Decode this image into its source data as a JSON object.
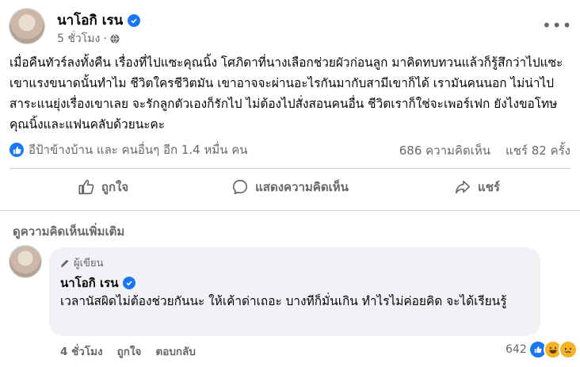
{
  "post": {
    "author": "นาโอกิ เรน",
    "time": "5 ชั่วโมง",
    "body": "เมื่อคืนทัวร์ลงทั้งคืน เรื่องที่ไปแซะคุณนิ้ง โศภิดาที่นางเลือกช่วยผัวก่อนลูก มาคิดทบทวนแล้วก็รู้สึกว่าไปแซะเขาแรงขนาดนั้นทำไม ชีวิตใครชีวิตมัน เขาอาจจะผ่านอะไรกันมากับสามีเขาก็ได้ เรามันคนนอก ไม่น่าไปสาระแนยุ่งเรื่องเขาเลย จะรักลูกตัวเองก็รักไป ไม่ต้องไปสั่งสอนคนอื่น ชีวิตเราก็ใช่จะเพอร์เฟก ยังไงขอโทษคุณนิ้งและแฟนคลับด้วยนะคะ",
    "reaction_summary": "อีป้าข้างบ้าน และ คนอื่นๆ อีก 1.4 หมื่น คน",
    "comments_count": "686 ความคิดเห็น",
    "shares_count": "แชร์ 82 ครั้ง"
  },
  "actions": {
    "like": "ถูกใจ",
    "comment": "แสดงความคิดเห็น",
    "share": "แชร์"
  },
  "more_comments": "ดูความคิดเห็นเพิ่มเติม",
  "comment": {
    "badge": "ผู้เขียน",
    "author": "นาโอกิ เรน",
    "text": "เวลานัสผิดไม่ต้องช่วยกันนะ ให้เค้าด่าเถอะ บางทีก็มั่นเกิน ทำไรไม่ค่อยคิด จะได้เรียนรู้",
    "time": "4 ชั่วโมง",
    "like": "ถูกใจ",
    "reply": "ตอบกลับ",
    "reaction_count": "642"
  },
  "colors": {
    "accent": "#1877f2",
    "secondary_text": "#65676b",
    "bubble": "#f0f2f5"
  },
  "icons": [
    "verified-icon",
    "globe-icon",
    "more-icon",
    "like-icon",
    "comment-icon",
    "share-icon",
    "pencil-icon",
    "laugh-icon",
    "cry-icon"
  ]
}
